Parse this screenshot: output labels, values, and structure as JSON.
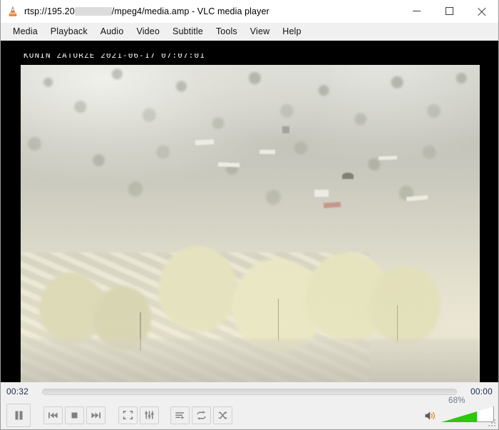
{
  "window": {
    "app_icon": "vlc-cone-icon",
    "title_prefix": "rtsp://195.20",
    "title_redacted": true,
    "title_suffix": "/mpeg4/media.amp - VLC media player",
    "minimize_label": "Minimize",
    "maximize_label": "Maximize",
    "close_label": "Close",
    "resize_grip_label": "Resize"
  },
  "menubar": {
    "items": [
      {
        "label": "Media"
      },
      {
        "label": "Playback"
      },
      {
        "label": "Audio"
      },
      {
        "label": "Video"
      },
      {
        "label": "Subtitle"
      },
      {
        "label": "Tools"
      },
      {
        "label": "View"
      },
      {
        "label": "Help"
      }
    ]
  },
  "video": {
    "osd_text": "KONIN  ZATORZE 2021-06-17 07:07:01",
    "letterbox_color": "#000000",
    "scene_description": "Washed-out CCTV view of a wooded hillside with houses and terraced paths"
  },
  "playback": {
    "elapsed": "00:32",
    "remaining": "00:00",
    "seek_position_percent": 0,
    "seekbar_label": "Seek bar"
  },
  "controls": {
    "play_pause": {
      "label": "Pause",
      "icon": "pause-icon",
      "state": "playing"
    },
    "previous": {
      "label": "Previous",
      "icon": "previous-icon"
    },
    "stop": {
      "label": "Stop",
      "icon": "stop-icon"
    },
    "next": {
      "label": "Next",
      "icon": "next-icon"
    },
    "fullscreen": {
      "label": "Toggle fullscreen",
      "icon": "fullscreen-icon"
    },
    "extended": {
      "label": "Show extended settings",
      "icon": "equalizer-icon"
    },
    "playlist": {
      "label": "Show playlist",
      "icon": "playlist-icon"
    },
    "loop": {
      "label": "Click to toggle between loop all, loop one and no loop",
      "icon": "loop-icon"
    },
    "shuffle": {
      "label": "Random",
      "icon": "shuffle-icon"
    }
  },
  "volume": {
    "label": "Volume",
    "value": "68%",
    "percent": 68,
    "mute_icon": "speaker-icon",
    "fill_color": "#2fc60f",
    "accent_color": "#ff8c00"
  }
}
